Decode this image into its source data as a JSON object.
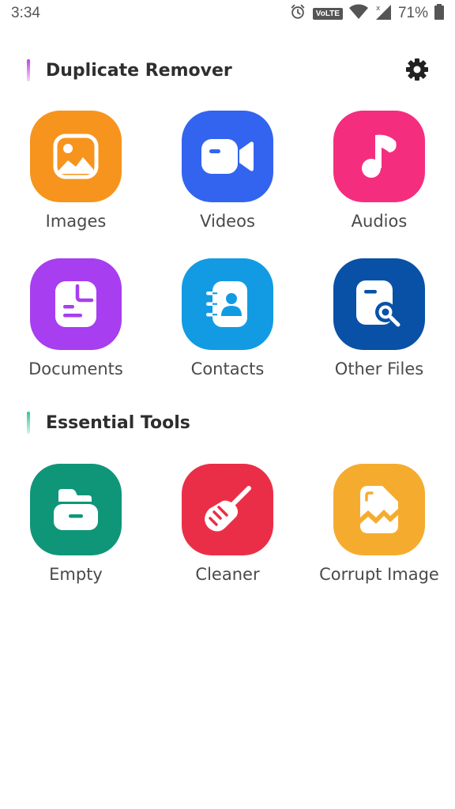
{
  "status_bar": {
    "time": "3:34",
    "volte_label": "VoLTE",
    "battery_percent": "71%",
    "icons": [
      "alarm-icon",
      "volte-icon",
      "wifi-icon",
      "signal-icon",
      "battery-icon"
    ]
  },
  "duplicate_section": {
    "title": "Duplicate Remover",
    "accent_color": "#c73ee8",
    "settings_icon": "gear-icon",
    "items": [
      {
        "label": "Images",
        "color": "#f7941d",
        "icon": "image-icon"
      },
      {
        "label": "Videos",
        "color": "#3364f0",
        "icon": "video-icon"
      },
      {
        "label": "Audios",
        "color": "#f42d7f",
        "icon": "music-icon"
      },
      {
        "label": "Documents",
        "color": "#a73ef0",
        "icon": "document-icon"
      },
      {
        "label": "Contacts",
        "color": "#129be2",
        "icon": "contacts-icon"
      },
      {
        "label": "Other Files",
        "color": "#0951a6",
        "icon": "file-search-icon"
      }
    ]
  },
  "tools_section": {
    "title": "Essential Tools",
    "accent_color": "#2ec79a",
    "items": [
      {
        "label": "Empty",
        "color": "#0f9679",
        "icon": "empty-folder-icon"
      },
      {
        "label": "Cleaner",
        "color": "#eb2e47",
        "icon": "broom-icon"
      },
      {
        "label": "Corrupt Image",
        "color": "#f5ac2e",
        "icon": "corrupt-image-icon"
      }
    ]
  }
}
